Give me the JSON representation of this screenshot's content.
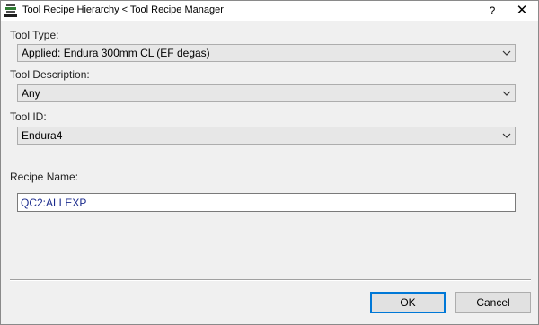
{
  "window": {
    "title": "Tool Recipe Hierarchy < Tool Recipe Manager",
    "help_label": "?",
    "close_label": "✕",
    "app_icon": "tool-stack-icon"
  },
  "form": {
    "tool_type": {
      "label": "Tool Type:",
      "value": "Applied: Endura 300mm CL (EF degas)"
    },
    "tool_description": {
      "label": "Tool Description:",
      "value": "Any"
    },
    "tool_id": {
      "label": "Tool ID:",
      "value": "Endura4"
    },
    "recipe_name": {
      "label": "Recipe Name:",
      "value": "QC2:ALLEXP"
    }
  },
  "buttons": {
    "ok_label": "OK",
    "cancel_label": "Cancel"
  },
  "colors": {
    "accent": "#0078d7",
    "recipe_text": "#1a2a8c"
  }
}
